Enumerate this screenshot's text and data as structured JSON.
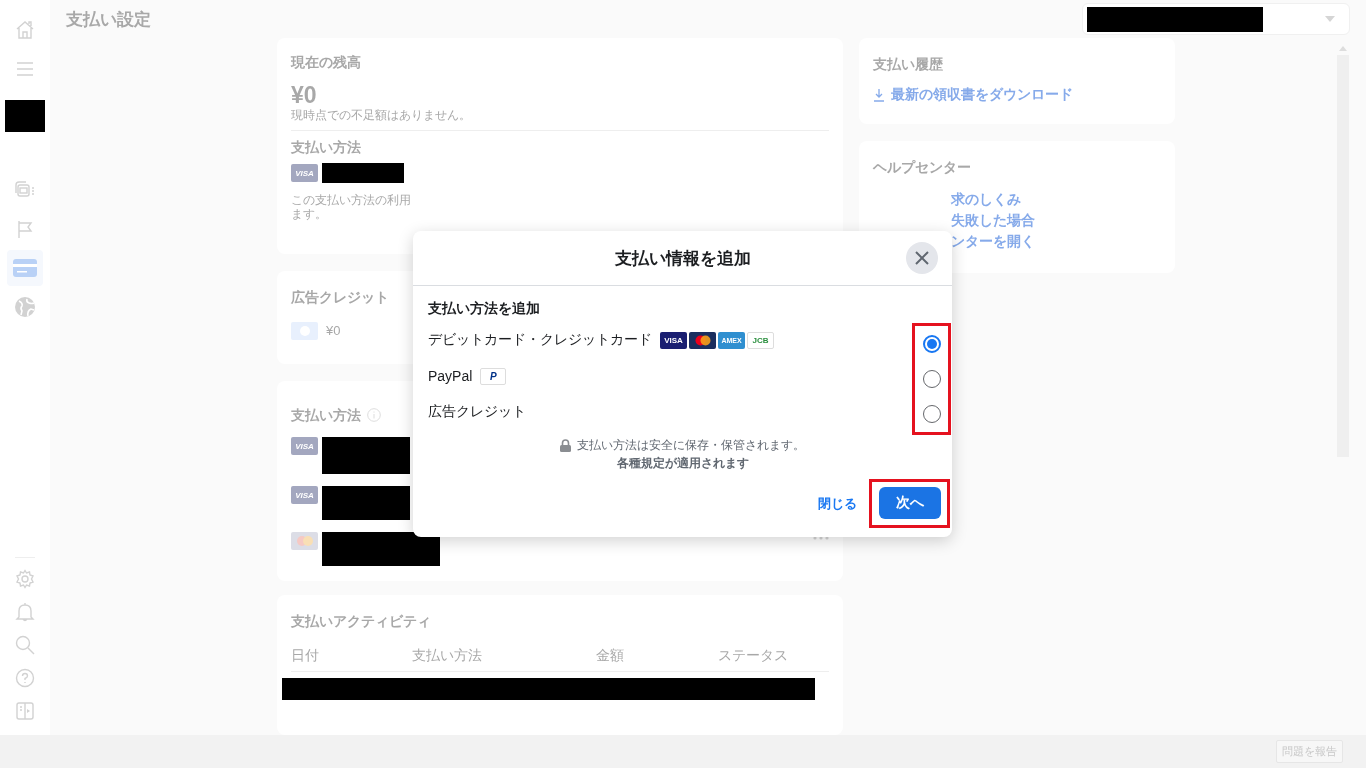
{
  "header": {
    "title": "支払い設定"
  },
  "nav_items": [
    {
      "selected": false
    },
    {
      "selected": false
    },
    {
      "selected": false
    },
    {
      "selected": false
    },
    {
      "selected": true
    },
    {
      "selected": false
    }
  ],
  "balance_card": {
    "title": "現在の残高",
    "amount": "¥0",
    "note": "現時点での不足額はありません。",
    "method_heading": "支払い方法",
    "method_badge": "VISA",
    "usage_note_lines": [
      "この支払い方法の利用",
      "ます。"
    ]
  },
  "ad_credit_card": {
    "title": "広告クレジット",
    "amount": "¥0"
  },
  "payment_methods_card": {
    "title": "支払い方法",
    "methods": [
      {
        "kind": "visa",
        "badge": "VISA"
      },
      {
        "kind": "visa",
        "badge": "VISA"
      },
      {
        "kind": "mastercard"
      }
    ]
  },
  "activity_card": {
    "title": "支払いアクティビティ",
    "columns": [
      "日付",
      "支払い方法",
      "金額",
      "ステータス"
    ]
  },
  "history_card": {
    "title": "支払い履歴",
    "link": "最新の領収書をダウンロード"
  },
  "help_card": {
    "title": "ヘルプセンター",
    "links": [
      "求のしくみ",
      "失敗した場合",
      "ンターを開く"
    ]
  },
  "report_button": "問題を報告",
  "dialog": {
    "title": "支払い情報を追加",
    "heading": "支払い方法を追加",
    "options": [
      {
        "label": "デビットカード・クレジットカード",
        "selected": true,
        "logos": [
          {
            "kind": "visa",
            "text": "VISA"
          },
          {
            "kind": "mastercard"
          },
          {
            "kind": "amex",
            "text": "AMEX"
          },
          {
            "kind": "jcb",
            "text": "JCB"
          }
        ]
      },
      {
        "label": "PayPal",
        "selected": false,
        "logos": [
          {
            "kind": "paypal",
            "text": "P"
          }
        ]
      },
      {
        "label": "広告クレジット",
        "selected": false
      }
    ],
    "security_note": "支払い方法は安全に保存・保管されます。",
    "terms_note": "各種規定が適用されます",
    "close_label": "閉じる",
    "next_label": "次へ"
  }
}
